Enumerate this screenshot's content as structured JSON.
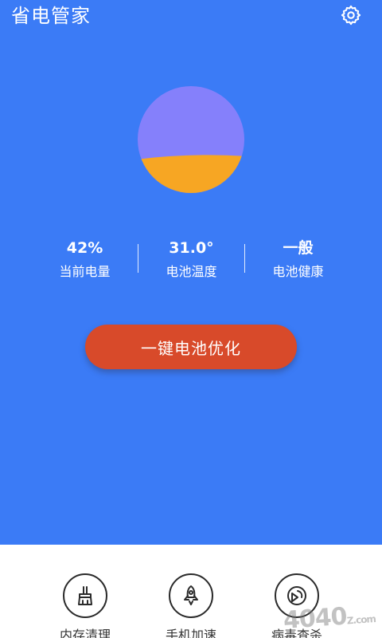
{
  "header": {
    "title": "省电管家",
    "settings_icon": "gear-icon"
  },
  "battery": {
    "level_fraction": 0.42,
    "top_color": "#8580fb",
    "fill_color": "#f7a623"
  },
  "stats": [
    {
      "value": "42%",
      "label": "当前电量"
    },
    {
      "value": "31.0°",
      "label": "电池温度"
    },
    {
      "value": "一般",
      "label": "电池健康"
    }
  ],
  "action": {
    "optimize_label": "一键电池优化",
    "color": "#d84a2a"
  },
  "tools": [
    {
      "label": "内存清理",
      "icon": "broom-icon"
    },
    {
      "label": "手机加速",
      "icon": "rocket-icon"
    },
    {
      "label": "病毒查杀",
      "icon": "shield-scan-icon"
    }
  ],
  "watermark": {
    "text": "4040",
    "suffix": "Z.com"
  },
  "colors": {
    "background": "#3b7bf6",
    "panel": "#ffffff"
  }
}
